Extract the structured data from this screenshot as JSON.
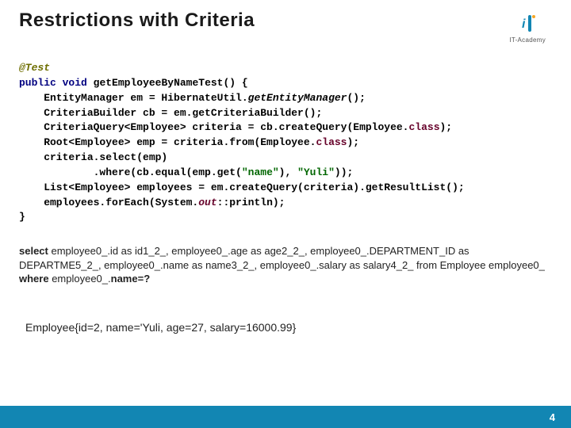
{
  "title": "Restrictions with Criteria",
  "logo_text": "IT-Academy",
  "code": {
    "anno": "@Test",
    "kw_public": "public",
    "kw_void": "void",
    "method": "getEmployeeByNameTest",
    "brace_open": "() {",
    "l1a": "    EntityManager em = HibernateUtil.",
    "l1b": "getEntityManager",
    "l1c": "();",
    "l2": "    CriteriaBuilder cb = em.getCriteriaBuilder();",
    "l3a": "    CriteriaQuery<Employee> criteria = cb.createQuery(Employee.",
    "l3b": "class",
    "l3c": ");",
    "l4a": "    Root<Employee> emp = criteria.from(Employee.",
    "l4b": "class",
    "l4c": ");",
    "l5": "    criteria.select(emp)",
    "l6a": "            .where(cb.equal(emp.get(",
    "l6b": "\"name\"",
    "l6c": "), ",
    "l6d": "\"Yuli\"",
    "l6e": "));",
    "l7": "    List<Employee> employees = em.createQuery(criteria).getResultList();",
    "l8a": "    employees.forEach(System.",
    "l8b": "out",
    "l8c": "::println);",
    "brace_close": "}"
  },
  "sql": {
    "select": "select",
    "body": " employee0_.id as id1_2_, employee0_.age as age2_2_, employee0_.DEPARTMENT_ID as DEPARTME5_2_, employee0_.name as name3_2_, employee0_.salary as salary4_2_ from Employee employee0_ ",
    "where": "where",
    "tail": " employee0_.",
    "nameq": "name=?"
  },
  "result": "Employee{id=2, name='Yuli, age=27, salary=16000.99}",
  "page": "4"
}
